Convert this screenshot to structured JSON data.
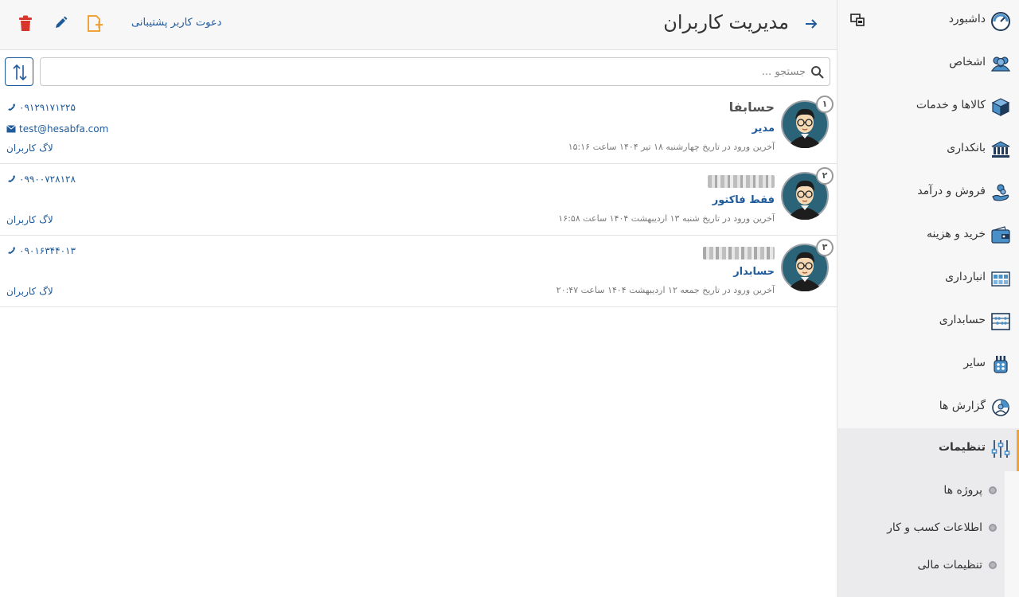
{
  "header": {
    "title": "مدیریت کاربران",
    "invite_label": "دعوت کاربر پشتیبانی"
  },
  "search": {
    "placeholder": "جستجو ..."
  },
  "sidebar": {
    "items": [
      {
        "label": "داشبورد",
        "icon": "dashboard-icon"
      },
      {
        "label": "اشخاص",
        "icon": "people-icon"
      },
      {
        "label": "کالاها و خدمات",
        "icon": "box-icon"
      },
      {
        "label": "بانکداری",
        "icon": "bank-icon"
      },
      {
        "label": "فروش و درآمد",
        "icon": "income-icon"
      },
      {
        "label": "خرید و هزینه",
        "icon": "wallet-icon"
      },
      {
        "label": "انبارداری",
        "icon": "warehouse-icon"
      },
      {
        "label": "حسابداری",
        "icon": "abacus-icon"
      },
      {
        "label": "سایر",
        "icon": "other-icon"
      },
      {
        "label": "گزارش ها",
        "icon": "report-icon"
      },
      {
        "label": "تنظیمات",
        "icon": "settings-icon",
        "active": true
      }
    ],
    "submenu": [
      {
        "label": "پروژه ها"
      },
      {
        "label": "اطلاعات کسب و کار"
      },
      {
        "label": "تنظیمات مالی"
      }
    ]
  },
  "users": [
    {
      "num": "۱",
      "name": "حسابفا",
      "role": "مدیر",
      "last_login": "آخرین ورود در تاریخ چهارشنبه ۱۸ تیر ۱۴۰۴ ساعت ۱۵:۱۶",
      "phone": "۰۹۱۲۹۱۷۱۲۲۵",
      "email": "test@hesabfa.com",
      "log_label": "لاگ کاربران"
    },
    {
      "num": "۲",
      "name": "",
      "role": "فقط فاکتور",
      "last_login": "آخرین ورود در تاریخ شنبه ۱۳ اردیبهشت ۱۴۰۴ ساعت ۱۶:۵۸",
      "phone": "۰۹۹۰۰۷۲۸۱۲۸",
      "email": "",
      "log_label": "لاگ کاربران"
    },
    {
      "num": "۳",
      "name": "",
      "role": "حسابدار",
      "last_login": "آخرین ورود در تاریخ جمعه ۱۲ اردیبهشت ۱۴۰۴ ساعت ۲۰:۴۷",
      "phone": "۰۹۰۱۶۳۴۴۰۱۳",
      "email": "",
      "log_label": "لاگ کاربران"
    }
  ],
  "colors": {
    "accent": "#1f5a9a",
    "active_indicator": "#f0a33a",
    "delete": "#d9362b",
    "add_user": "#f0a33a"
  }
}
